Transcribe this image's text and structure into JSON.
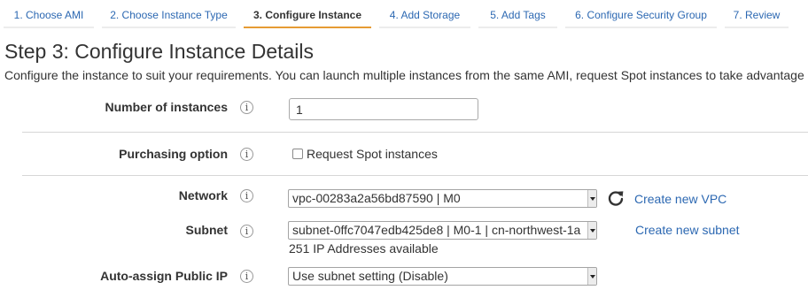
{
  "tabs": [
    {
      "label": "1. Choose AMI"
    },
    {
      "label": "2. Choose Instance Type"
    },
    {
      "label": "3. Configure Instance"
    },
    {
      "label": "4. Add Storage"
    },
    {
      "label": "5. Add Tags"
    },
    {
      "label": "6. Configure Security Group"
    },
    {
      "label": "7. Review"
    }
  ],
  "active_tab": "3. Configure Instance",
  "page": {
    "title": "Step 3: Configure Instance Details",
    "description": "Configure the instance to suit your requirements. You can launch multiple instances from the same AMI, request Spot instances to take advantage"
  },
  "form": {
    "instances": {
      "label": "Number of instances",
      "value": "1"
    },
    "purchasing": {
      "label": "Purchasing option",
      "checkbox_label": "Request Spot instances",
      "checked": false
    },
    "network": {
      "label": "Network",
      "selected": "vpc-00283a2a56bd87590 | M0",
      "link": "Create new VPC"
    },
    "subnet": {
      "label": "Subnet",
      "selected": "subnet-0ffc7047edb425de8 | M0-1 | cn-northwest-1a",
      "link": "Create new subnet",
      "hint": "251 IP Addresses available"
    },
    "public_ip": {
      "label": "Auto-assign Public IP",
      "selected": "Use subnet setting (Disable)"
    }
  },
  "icons": {
    "info": "info-icon",
    "refresh": "refresh-icon",
    "info_glyph": "i"
  },
  "colors": {
    "link": "#2c68b2",
    "active_tab_underline": "#e69b34",
    "text": "#333333"
  }
}
